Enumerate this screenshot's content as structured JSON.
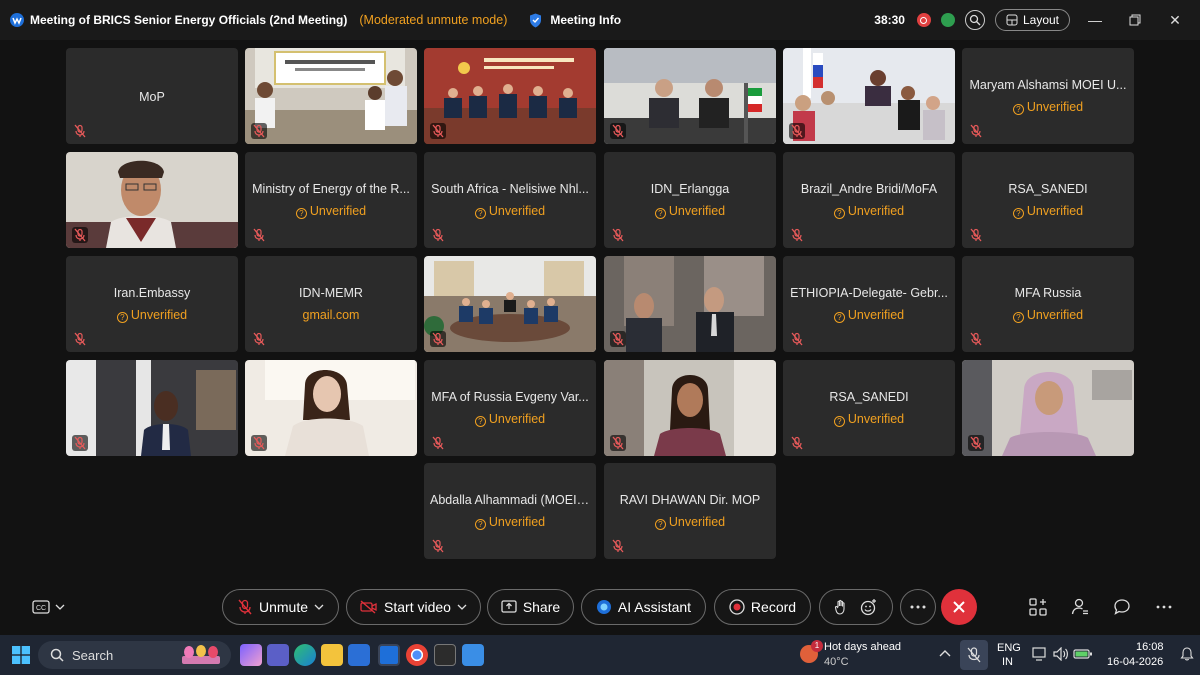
{
  "window": {
    "title": "Meeting of BRICS Senior Energy Officials  (2nd Meeting)",
    "mode": "(Moderated unmute mode)",
    "meeting_info": "Meeting Info",
    "timer": "38:30",
    "layout_label": "Layout"
  },
  "tiles": [
    {
      "name": "MoP",
      "status": ""
    },
    {
      "name": "",
      "status": "",
      "video": "conference-room"
    },
    {
      "name": "",
      "status": "",
      "video": "chinese-delegation"
    },
    {
      "name": "",
      "status": "",
      "video": "iran-delegation"
    },
    {
      "name": "",
      "status": "",
      "video": "russia-delegation"
    },
    {
      "name": "Maryam Alshamsi MOEI U...",
      "status": "Unverified"
    },
    {
      "name": "",
      "status": "",
      "video": "man-glasses"
    },
    {
      "name": "Ministry of Energy of the R...",
      "status": "Unverified"
    },
    {
      "name": "South Africa - Nelisiwe Nhl...",
      "status": "Unverified"
    },
    {
      "name": "IDN_Erlangga",
      "status": "Unverified"
    },
    {
      "name": "Brazil_Andre Bridi/MoFA",
      "status": "Unverified"
    },
    {
      "name": "RSA_SANEDI",
      "status": "Unverified"
    },
    {
      "name": "Iran.Embassy",
      "status": "Unverified"
    },
    {
      "name": "IDN-MEMR",
      "status": "gmail.com"
    },
    {
      "name": "",
      "status": "",
      "video": "meeting-table"
    },
    {
      "name": "",
      "status": "",
      "video": "two-men"
    },
    {
      "name": "ETHIOPIA-Delegate- Gebr...",
      "status": "Unverified"
    },
    {
      "name": "MFA Russia",
      "status": "Unverified"
    },
    {
      "name": "",
      "status": "",
      "video": "man-suit"
    },
    {
      "name": "",
      "status": "",
      "video": "woman-office"
    },
    {
      "name": "MFA of Russia Evgeny Var...",
      "status": "Unverified"
    },
    {
      "name": "",
      "status": "",
      "video": "young-woman"
    },
    {
      "name": "RSA_SANEDI",
      "status": "Unverified"
    },
    {
      "name": "",
      "status": "",
      "video": "woman-hijab"
    },
    {
      "name": "Abdalla Alhammadi (MOEI ...",
      "status": "Unverified"
    },
    {
      "name": "RAVI DHAWAN Dir. MOP",
      "status": "Unverified"
    }
  ],
  "toolbar": {
    "unmute": "Unmute",
    "start_video": "Start video",
    "share": "Share",
    "ai_assistant": "AI Assistant",
    "record": "Record"
  },
  "taskbar": {
    "search": "Search",
    "weather_title": "Hot days ahead",
    "weather_temp": "40°C",
    "lang": "ENG",
    "region": "IN",
    "time": "16:08",
    "date": "16-04-2026",
    "weather_badge": "1"
  },
  "colors": {
    "accent_unverified": "#f0a020",
    "leave_red": "#e0313b",
    "background": "#121212",
    "tile": "#2b2b2b"
  }
}
